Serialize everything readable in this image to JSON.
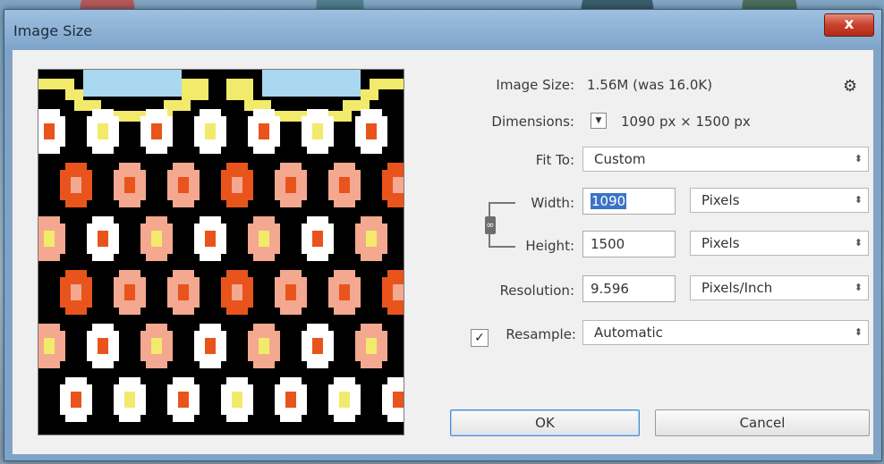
{
  "window": {
    "title": "Image Size",
    "close_label": "x"
  },
  "info": {
    "image_size_label": "Image Size:",
    "image_size_value": "1.56M (was 16.0K)",
    "dimensions_label": "Dimensions:",
    "dimensions_value": "1090 px  ×  1500 px"
  },
  "fit_to": {
    "label": "Fit To:",
    "value": "Custom"
  },
  "width": {
    "label": "Width:",
    "value": "1090",
    "unit": "Pixels"
  },
  "height": {
    "label": "Height:",
    "value": "1500",
    "unit": "Pixels"
  },
  "resolution": {
    "label": "Resolution:",
    "value": "9.596",
    "unit": "Pixels/Inch"
  },
  "resample": {
    "label": "Resample:",
    "checked": true,
    "value": "Automatic"
  },
  "buttons": {
    "ok": "OK",
    "cancel": "Cancel"
  },
  "icons": {
    "gear": "gear-icon",
    "link": "chain-link-icon",
    "dropdown": "updown-arrow-icon"
  },
  "colors": {
    "accent": "#3b74c6",
    "titlebar": "#8fb2d6",
    "close": "#c8412d",
    "pattern_black": "#000000",
    "pattern_orange": "#e8541c",
    "pattern_salmon": "#f4a890",
    "pattern_yellow": "#f2ea6a",
    "pattern_sky": "#a9d8f0",
    "pattern_white": "#ffffff"
  }
}
